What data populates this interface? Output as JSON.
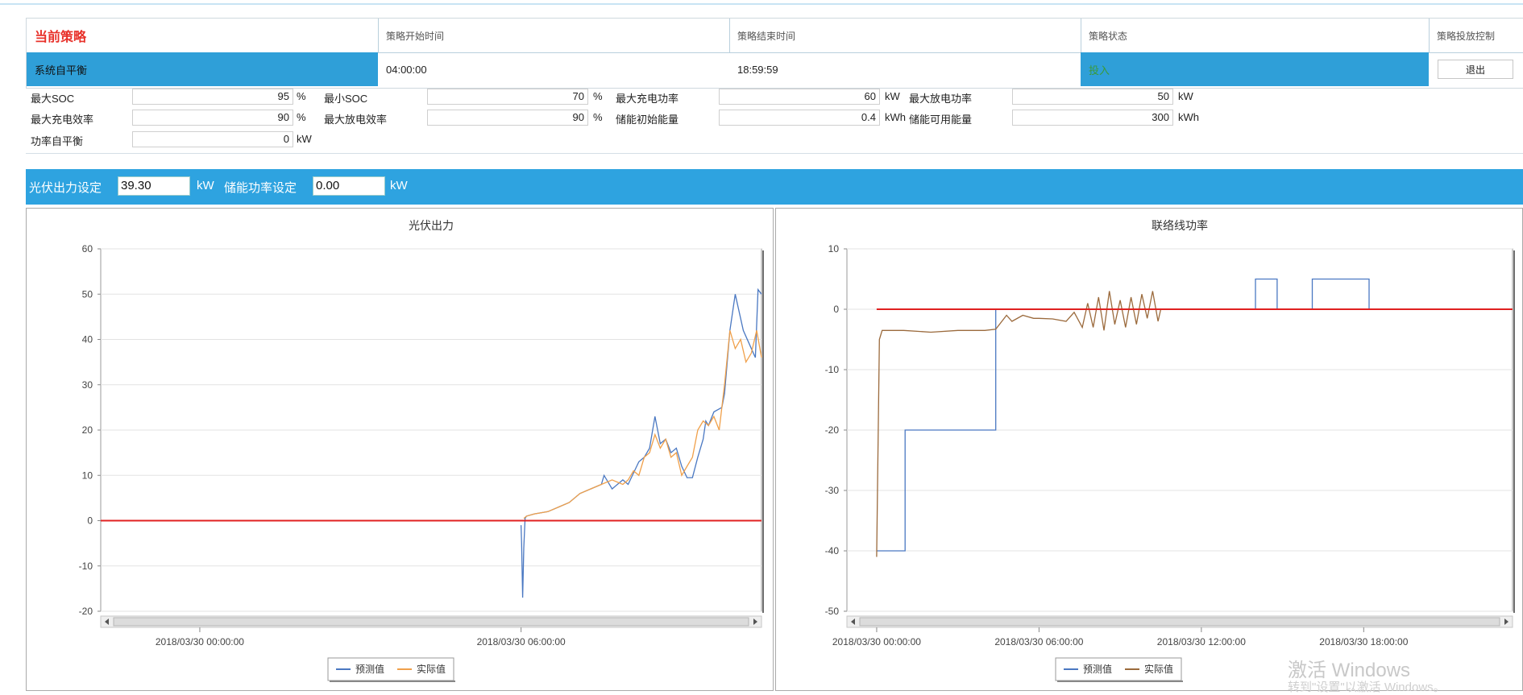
{
  "strategy": {
    "title": "当前策略",
    "headers": {
      "start": "策略开始时间",
      "end": "策略结束时间",
      "status": "策略状态",
      "control": "策略投放控制"
    },
    "row": {
      "name": "系统自平衡",
      "start": "04:00:00",
      "end": "18:59:59",
      "status": "投入",
      "action": "退出"
    }
  },
  "params": [
    {
      "label": "最大SOC",
      "value": "95",
      "unit": "%"
    },
    {
      "label": "最小SOC",
      "value": "70",
      "unit": "%"
    },
    {
      "label": "最大充电功率",
      "value": "60",
      "unit": "kW"
    },
    {
      "label": "最大放电功率",
      "value": "50",
      "unit": "kW"
    },
    {
      "label": "最大充电效率",
      "value": "90",
      "unit": "%"
    },
    {
      "label": "最大放电效率",
      "value": "90",
      "unit": "%"
    },
    {
      "label": "储能初始能量",
      "value": "0.4",
      "unit": "kWh"
    },
    {
      "label": "储能可用能量",
      "value": "300",
      "unit": "kWh"
    },
    {
      "label": "功率自平衡",
      "value": "0",
      "unit": "kW"
    }
  ],
  "setbar": {
    "pv_label": "光伏出力设定",
    "pv_value": "39.30",
    "pv_unit": "kW",
    "st_label": "储能功率设定",
    "st_value": "0.00",
    "st_unit": "kW"
  },
  "chart_data": [
    {
      "type": "line",
      "title": "光伏出力",
      "ylim": [
        -20,
        60
      ],
      "yticks": [
        "60",
        "50",
        "40",
        "30",
        "20",
        "10",
        "0",
        "-10",
        "-20"
      ],
      "xticks": [
        "2018/03/30 00:00:00",
        "2018/03/30 06:00:00"
      ],
      "legend": [
        "预测值",
        "实际值"
      ],
      "series": [
        {
          "name": "预测值",
          "color": "#4a78c2",
          "x": [
            6,
            6.02,
            6.06,
            6.1,
            6.15,
            6.2,
            6.5,
            7,
            7.4,
            7.8,
            8.2,
            8.6,
            9,
            9.1,
            9.2,
            9.4,
            9.8,
            10,
            10.4,
            10.6,
            10.8,
            11,
            11.2,
            11.4,
            11.6,
            11.8,
            12,
            12.2,
            12.4,
            12.6,
            12.8,
            12.9,
            13,
            13.2,
            13.5,
            13.6,
            13.8,
            14,
            14.3,
            14.6,
            14.75,
            14.85,
            14.98
          ],
          "y": [
            -1,
            -5,
            -17,
            -6,
            0.5,
            1,
            1.5,
            2,
            3,
            4,
            6,
            7,
            8,
            10,
            9,
            7,
            9,
            8,
            13,
            14,
            16,
            23,
            17,
            18,
            15,
            16,
            12,
            9.5,
            9.5,
            14,
            18,
            22,
            21,
            24,
            25,
            28,
            42,
            50,
            42,
            38,
            36,
            51,
            50
          ]
        },
        {
          "name": "实际值",
          "color": "#f0a04a",
          "x": [
            6.1,
            6.2,
            6.5,
            7,
            7.4,
            7.8,
            8.2,
            8.6,
            9,
            9.4,
            9.8,
            10,
            10.2,
            10.4,
            10.6,
            10.8,
            11,
            11.2,
            11.4,
            11.6,
            11.8,
            12,
            12.2,
            12.4,
            12.6,
            12.8,
            13,
            13.2,
            13.4,
            13.6,
            13.8,
            14,
            14.2,
            14.4,
            14.6,
            14.8,
            14.98
          ],
          "y": [
            0.5,
            1,
            1.5,
            2,
            3,
            4,
            6,
            7,
            8,
            9,
            8,
            9,
            11,
            10,
            14,
            15,
            19,
            16,
            18,
            14,
            15,
            10,
            12,
            14,
            20,
            22,
            21,
            23,
            20,
            30,
            42,
            38,
            40,
            35,
            37,
            42,
            36
          ]
        }
      ]
    },
    {
      "type": "line",
      "title": "联络线功率",
      "ylim": [
        -50,
        10
      ],
      "yticks": [
        "10",
        "0",
        "-10",
        "-20",
        "-30",
        "-40",
        "-50"
      ],
      "xticks": [
        "2018/03/30 00:00:00",
        "2018/03/30 06:00:00",
        "2018/03/30 12:00:00",
        "2018/03/30 18:00:00"
      ],
      "legend": [
        "预测值",
        "实际值"
      ],
      "series": [
        {
          "name": "预测值",
          "color": "#4a78c2",
          "x": [
            0,
            1.05,
            1.05,
            4.4,
            4.4,
            6,
            8,
            10,
            12,
            14,
            14,
            14.8,
            14.8,
            16.1,
            16.1,
            18.2,
            18.2,
            23.5
          ],
          "y": [
            -40,
            -40,
            -20,
            -20,
            0,
            0,
            0,
            0,
            0,
            0,
            5,
            5,
            0,
            0,
            5,
            5,
            0,
            0
          ]
        },
        {
          "name": "实际值",
          "color": "#9b6a3c",
          "x": [
            0,
            0.1,
            0.2,
            1,
            2,
            3,
            4,
            4.4,
            4.8,
            5,
            5.4,
            5.8,
            6,
            6.5,
            7,
            7.3,
            7.6,
            7.8,
            8,
            8.2,
            8.4,
            8.6,
            8.8,
            9,
            9.2,
            9.4,
            9.6,
            9.8,
            10,
            10.2,
            10.4,
            10.5
          ],
          "y": [
            -41,
            -5,
            -3.5,
            -3.5,
            -3.8,
            -3.5,
            -3.5,
            -3.3,
            -1,
            -2,
            -1,
            -1.5,
            -1.5,
            -1.6,
            -2,
            -0.5,
            -3,
            1,
            -3,
            2,
            -3.5,
            3,
            -2.5,
            1.5,
            -3,
            2,
            -2.5,
            2.5,
            -1.5,
            3,
            -2,
            0
          ]
        },
        {
          "name": "baseline",
          "color": "#e02020",
          "x": [
            0,
            23.5
          ],
          "y": [
            0,
            0
          ]
        }
      ]
    }
  ],
  "watermark": {
    "line1": "激活 Windows",
    "line2": "转到\"设置\"以激活 Windows。"
  },
  "colors": {
    "accent": "#2ea3e0",
    "title_red": "#e8312a",
    "zero_line": "#e02020"
  }
}
